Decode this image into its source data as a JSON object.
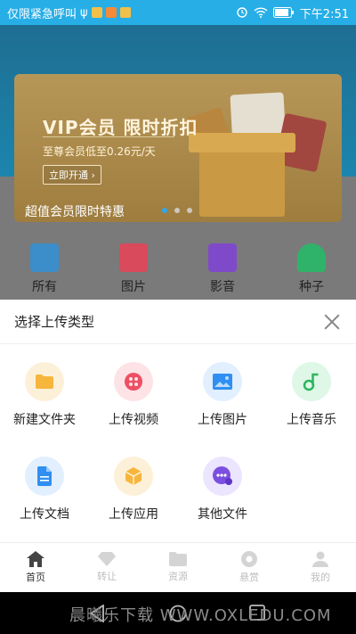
{
  "status_bar": {
    "left_text": "仅限紧急呼叫",
    "usb_glyph": "ψ",
    "time": "下午2:51"
  },
  "background": {
    "banner": {
      "title": "VIP会员 限时折扣",
      "subtitle": "至尊会员低至0.26元/天",
      "button_label": "立即开通 ›",
      "caption": "超值会员限时特惠"
    },
    "categories": [
      {
        "label": "所有",
        "icon": "folder-icon",
        "color": "#3b8ec9"
      },
      {
        "label": "图片",
        "icon": "image-icon",
        "color": "#d94a5c"
      },
      {
        "label": "影音",
        "icon": "video-icon",
        "color": "#7f4ac9"
      },
      {
        "label": "种子",
        "icon": "magnet-icon",
        "color": "#2fb36a"
      }
    ]
  },
  "sheet": {
    "title": "选择上传类型",
    "options": [
      {
        "label": "新建文件夹",
        "icon": "folder-icon",
        "bg": "#fdf0d9",
        "color": "#f6b63c"
      },
      {
        "label": "上传视频",
        "icon": "video-reel-icon",
        "bg": "#fde3e5",
        "color": "#ee4f64"
      },
      {
        "label": "上传图片",
        "icon": "image-icon",
        "bg": "#e1efff",
        "color": "#2f8ff2"
      },
      {
        "label": "上传音乐",
        "icon": "music-icon",
        "bg": "#def7e7",
        "color": "#2cb55e"
      },
      {
        "label": "上传文档",
        "icon": "document-icon",
        "bg": "#e1efff",
        "color": "#2f8ff2"
      },
      {
        "label": "上传应用",
        "icon": "package-icon",
        "bg": "#fdf0d9",
        "color": "#f6b63c"
      },
      {
        "label": "其他文件",
        "icon": "chat-bubble-icon",
        "bg": "#ece5ff",
        "color": "#7b4fe0"
      }
    ]
  },
  "tabbar": {
    "tabs": [
      {
        "label": "首页",
        "icon": "home-icon",
        "active": true
      },
      {
        "label": "转让",
        "icon": "diamond-icon",
        "active": false
      },
      {
        "label": "资源",
        "icon": "folder-icon",
        "active": false
      },
      {
        "label": "悬赏",
        "icon": "plus-circle-icon",
        "active": false
      },
      {
        "label": "我的",
        "icon": "person-icon",
        "active": false
      }
    ]
  },
  "watermark": "晨曦乐下载 WWW.OXLEDU.COM"
}
